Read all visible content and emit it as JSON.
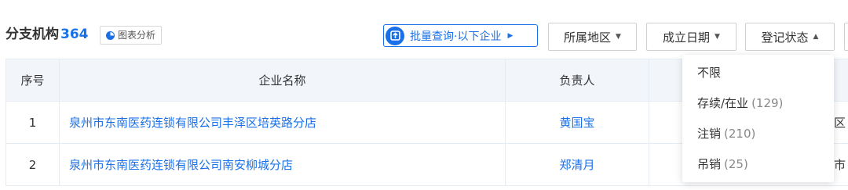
{
  "header": {
    "title": "分支机构",
    "count": "364",
    "chart_button": "图表分析",
    "batch_button": "批量查询·以下企业"
  },
  "filters": [
    {
      "label": "所属地区",
      "state": "collapsed"
    },
    {
      "label": "成立日期",
      "state": "collapsed"
    },
    {
      "label": "登记状态",
      "state": "expanded"
    }
  ],
  "table": {
    "columns": [
      "序号",
      "企业名称",
      "负责人"
    ],
    "rows": [
      {
        "index": "1",
        "name": "泉州市东南医药连锁有限公司丰泽区培英路分店",
        "owner": "黄国宝",
        "partial": "区"
      },
      {
        "index": "2",
        "name": "泉州市东南医药连锁有限公司南安柳城分店",
        "owner": "郑清月",
        "partial": "市"
      }
    ]
  },
  "status_dropdown": {
    "items": [
      {
        "label": "不限",
        "count": ""
      },
      {
        "label": "存续/在业",
        "count": "(129)"
      },
      {
        "label": "注销",
        "count": "(210)"
      },
      {
        "label": "吊销",
        "count": "(25)"
      }
    ]
  },
  "colors": {
    "accent": "#1a70e8",
    "header_bg": "#f2f6fb",
    "border": "#e6ecf4"
  }
}
